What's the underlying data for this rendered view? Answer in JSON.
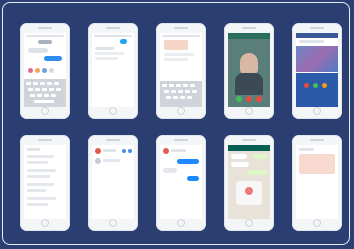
{
  "colors": {
    "background": "#2b3f73",
    "frame_border": "#e8ecf5",
    "phone_body": "#f4f5f7",
    "messenger_blue": "#1e88ff",
    "whatsapp_green": "#dcf8c6",
    "skype_header": "#2e8bd8",
    "facetime_green": "#40c057",
    "call_red": "#e74c3c",
    "video_bg": "#5a7f7a"
  },
  "phones": [
    {
      "icon": "imessage-screen-icon"
    },
    {
      "icon": "twitter-screen-icon"
    },
    {
      "icon": "notes-screen-icon"
    },
    {
      "icon": "video-call-screen-icon"
    },
    {
      "icon": "facebook-feed-screen-icon"
    },
    {
      "icon": "mail-list-screen-icon"
    },
    {
      "icon": "profile-list-screen-icon"
    },
    {
      "icon": "messenger-chat-screen-icon"
    },
    {
      "icon": "whatsapp-chat-screen-icon"
    },
    {
      "icon": "note-card-screen-icon"
    }
  ]
}
